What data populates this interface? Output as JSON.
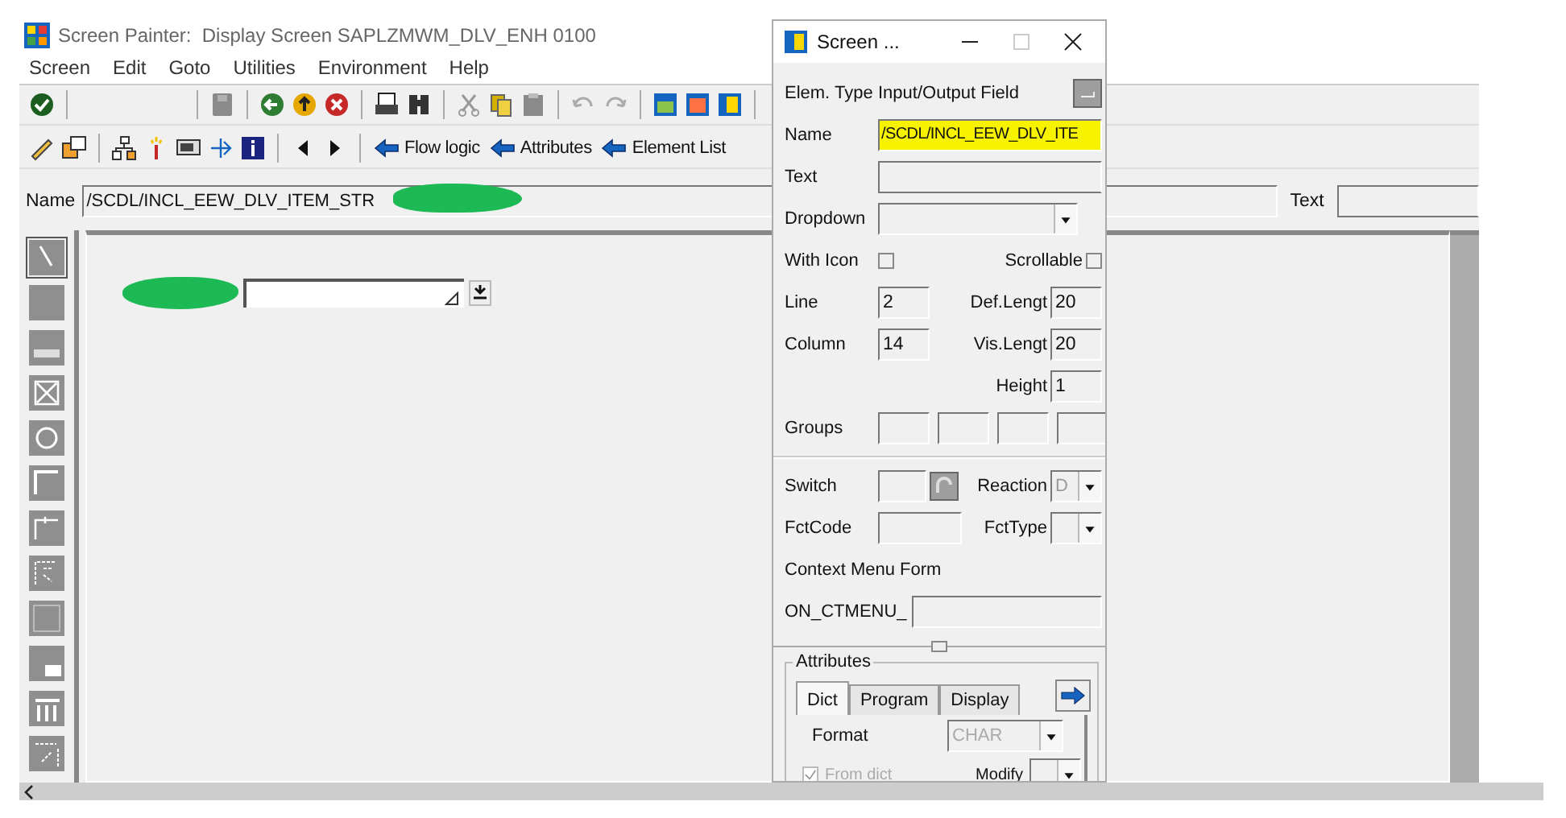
{
  "main_window": {
    "title": "Screen Painter:  Display Screen SAPLZMWM_DLV_ENH 0100"
  },
  "menu": [
    "Screen",
    "Edit",
    "Goto",
    "Utilities",
    "Environment",
    "Help"
  ],
  "nav_buttons": [
    {
      "label": "Flow logic"
    },
    {
      "label": "Attributes"
    },
    {
      "label": "Element List"
    }
  ],
  "name_bar": {
    "label": "Name",
    "value": "/SCDL/INCL_EEW_DLV_ITEM_STR",
    "text_label": "Text"
  },
  "dialog": {
    "title": "Screen ...",
    "elem_type_label": "Elem. Type",
    "elem_type": "Input/Output Field",
    "name": {
      "label": "Name",
      "value": "/SCDL/INCL_EEW_DLV_ITE",
      "highlighted": true
    },
    "text_label": "Text",
    "dropdown_label": "Dropdown",
    "with_icon": {
      "label": "With Icon",
      "checked": false
    },
    "scrollable": {
      "label": "Scrollable",
      "checked": false
    },
    "line": {
      "label": "Line",
      "value": "2"
    },
    "def_length": {
      "label": "Def.Lengt",
      "value": "20"
    },
    "column": {
      "label": "Column",
      "value": "14"
    },
    "vis_length": {
      "label": "Vis.Lengt",
      "value": "20"
    },
    "height": {
      "label": "Height",
      "value": "1"
    },
    "groups_label": "Groups",
    "switch_label": "Switch",
    "reaction": {
      "label": "Reaction",
      "value": "D"
    },
    "fctcode_label": "FctCode",
    "fcttype_label": "FctType",
    "context_menu_label": "Context Menu Form",
    "ctmenu_prefix": "ON_CTMENU_",
    "attributes": {
      "title": "Attributes",
      "tabs": [
        {
          "label": "Dict",
          "selected": true
        },
        {
          "label": "Program",
          "selected": false
        },
        {
          "label": "Display",
          "selected": false
        }
      ],
      "format": {
        "label": "Format",
        "value": "CHAR"
      },
      "from_dict": {
        "label": "From dict",
        "checked": true
      },
      "modify_label": "Modify"
    }
  }
}
